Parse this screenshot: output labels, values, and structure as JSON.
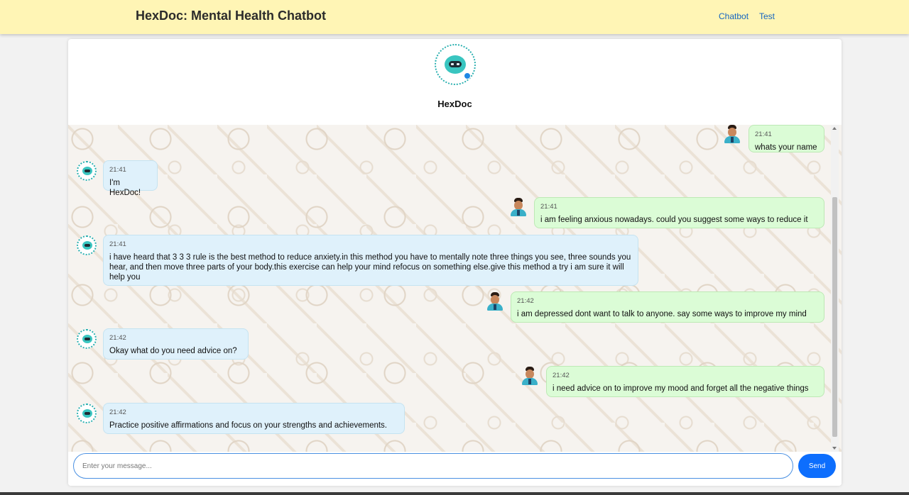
{
  "app": {
    "title": "HexDoc: Mental Health Chatbot"
  },
  "nav": {
    "chatbot": "Chatbot",
    "test": "Test"
  },
  "bot": {
    "name": "HexDoc"
  },
  "messages": [
    {
      "sender": "user",
      "time": "21:41",
      "text": "whats your name"
    },
    {
      "sender": "bot",
      "time": "21:41",
      "text": "I'm HexDoc!"
    },
    {
      "sender": "user",
      "time": "21:41",
      "text": "i am feeling anxious nowadays. could you suggest some ways to reduce it"
    },
    {
      "sender": "bot",
      "time": "21:41",
      "text": "i have heard that 3 3 3 rule is the best method to reduce anxiety.in this method you have to mentally note three things you see, three sounds you hear, and then move three parts of your body.this exercise can help your mind refocus on something else.give this method a try i am sure it will help you"
    },
    {
      "sender": "user",
      "time": "21:42",
      "text": "i am depressed dont want to talk to anyone. say some ways to improve my mind"
    },
    {
      "sender": "bot",
      "time": "21:42",
      "text": "Okay what do you need advice on?"
    },
    {
      "sender": "user",
      "time": "21:42",
      "text": "i need advice on to improve my mood and forget all the negative things"
    },
    {
      "sender": "bot",
      "time": "21:42",
      "text": "Practice positive affirmations and focus on your strengths and achievements."
    }
  ],
  "composer": {
    "placeholder": "Enter your message...",
    "send_label": "Send"
  },
  "colors": {
    "navbar": "#fff5b5",
    "bot_bubble": "#dff1fb",
    "user_bubble": "#dbfcd6",
    "send_button": "#0d6efd",
    "link": "#1565c0"
  }
}
